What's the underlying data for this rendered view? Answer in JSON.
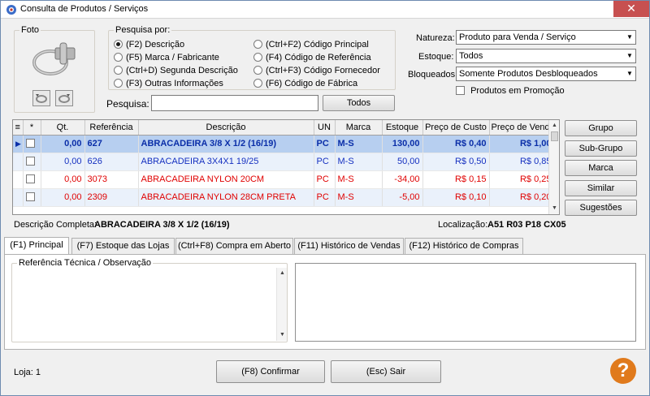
{
  "window": {
    "title": "Consulta de Produtos / Serviços",
    "close": "✕"
  },
  "photo": {
    "legend": "Foto"
  },
  "search_by": {
    "legend": "Pesquisa por:",
    "options_left": [
      "(F2) Descrição",
      "(F5) Marca / Fabricante",
      "(Ctrl+D) Segunda Descrição",
      "(F3) Outras Informações"
    ],
    "options_right": [
      "(Ctrl+F2) Código Principal",
      "(F4) Código de Referência",
      "(Ctrl+F3) Código Fornecedor",
      "(F6) Código de Fábrica"
    ],
    "selected": "(F2) Descrição"
  },
  "filters": {
    "natureza_label": "Natureza:",
    "natureza_value": "Produto para Venda / Serviço",
    "estoque_label": "Estoque:",
    "estoque_value": "Todos",
    "bloqueados_label": "Bloqueados:",
    "bloqueados_value": "Somente Produtos Desbloqueados",
    "promocao_label": "Produtos em Promoção"
  },
  "search": {
    "label": "Pesquisa:",
    "value": "",
    "todos_button": "Todos"
  },
  "grid": {
    "columns": [
      "*",
      "Qt.",
      "Referência",
      "Descrição",
      "UN",
      "Marca",
      "Estoque",
      "Preço de Custo",
      "Preço de Venda"
    ],
    "rows": [
      {
        "qt": "0,00",
        "ref": "627",
        "desc": "ABRACADEIRA 3/8 X 1/2 (16/19)",
        "un": "PC",
        "marca": "M-S",
        "estoque": "130,00",
        "custo": "R$ 0,40",
        "venda": "R$ 1,00"
      },
      {
        "qt": "0,00",
        "ref": "626",
        "desc": "ABRACADEIRA 3X4X1 19/25",
        "un": "PC",
        "marca": "M-S",
        "estoque": "50,00",
        "custo": "R$ 0,50",
        "venda": "R$ 0,85"
      },
      {
        "qt": "0,00",
        "ref": "3073",
        "desc": "ABRACADEIRA NYLON 20CM",
        "un": "PC",
        "marca": "M-S",
        "estoque": "-34,00",
        "custo": "R$ 0,15",
        "venda": "R$ 0,25"
      },
      {
        "qt": "0,00",
        "ref": "2309",
        "desc": "ABRACADEIRA NYLON 28CM PRETA",
        "un": "PC",
        "marca": "M-S",
        "estoque": "-5,00",
        "custo": "R$ 0,10",
        "venda": "R$ 0,20"
      }
    ]
  },
  "side_buttons": [
    "Grupo",
    "Sub-Grupo",
    "Marca",
    "Similar",
    "Sugestões"
  ],
  "details": {
    "desc_label": "Descrição Completa:",
    "desc_value": "ABRACADEIRA 3/8 X 1/2 (16/19)",
    "loc_label": "Localização:",
    "loc_value": "A51 R03 P18 CX05"
  },
  "tabs": [
    "(F1) Principal",
    "(F7) Estoque das Lojas",
    "(Ctrl+F8) Compra em Aberto",
    "(F11) Histórico de Vendas",
    "(F12) Histórico de Compras"
  ],
  "panel": {
    "ref_legend": "Referência Técnica / Observação"
  },
  "footer": {
    "loja": "Loja: 1",
    "confirm": "(F8) Confirmar",
    "exit": "(Esc) Sair",
    "help": "?"
  },
  "colors": {
    "selected_row": "#b7cff0",
    "blue_text": "#1530c0",
    "red_text": "#e00000",
    "help_orange": "#e07a1c"
  }
}
